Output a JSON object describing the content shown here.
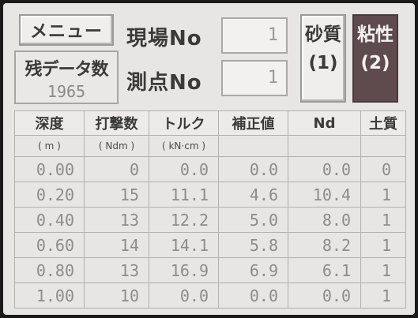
{
  "menu_button": {
    "label": "メニュー"
  },
  "remaining_data": {
    "label": "残データ数",
    "value": "1965"
  },
  "site": {
    "label": "現場No",
    "value": "1"
  },
  "point": {
    "label": "測点No",
    "value": "1"
  },
  "soil_type": {
    "sand": {
      "label": "砂質",
      "code": "(1)",
      "selected": false
    },
    "clay": {
      "label": "粘性",
      "code": "(2)",
      "selected": true
    }
  },
  "table": {
    "headers": [
      "深度",
      "打撃数",
      "トルク",
      "補正値",
      "Nd",
      "土質"
    ],
    "units": [
      "( m )",
      "( Ndm )",
      "( kN·cm )",
      "",
      "",
      ""
    ],
    "rows": [
      {
        "depth": "0.00",
        "blows": "0",
        "torque": "0.0",
        "correction": "0.0",
        "nd": "0.0",
        "soil": "0"
      },
      {
        "depth": "0.20",
        "blows": "15",
        "torque": "11.1",
        "correction": "4.6",
        "nd": "10.4",
        "soil": "1"
      },
      {
        "depth": "0.40",
        "blows": "13",
        "torque": "12.2",
        "correction": "5.0",
        "nd": "8.0",
        "soil": "1"
      },
      {
        "depth": "0.60",
        "blows": "14",
        "torque": "14.1",
        "correction": "5.8",
        "nd": "8.2",
        "soil": "1"
      },
      {
        "depth": "0.80",
        "blows": "13",
        "torque": "16.9",
        "correction": "6.9",
        "nd": "6.1",
        "soil": "1"
      },
      {
        "depth": "1.00",
        "blows": "10",
        "torque": "0.0",
        "correction": "0.0",
        "nd": "0.0",
        "soil": "1"
      }
    ]
  }
}
